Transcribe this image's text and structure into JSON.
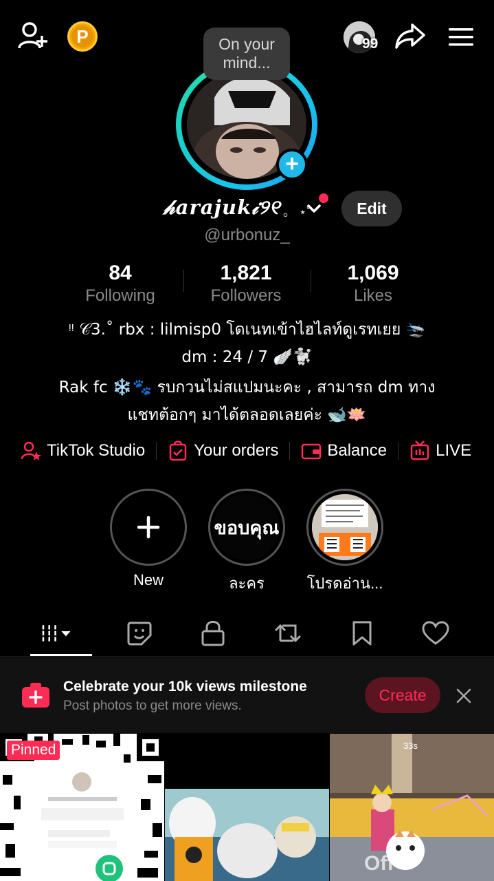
{
  "header": {
    "mind_bubble": "On your mind...",
    "friends_count_badge": "99",
    "icons": [
      "add-user-icon",
      "coin-icon",
      "share-icon",
      "menu-icon"
    ]
  },
  "profile": {
    "display_name": "𝒽arajuk𝒾୨୧",
    "name_decoration": "。 ⋆˚",
    "username": "@urbonuz_",
    "edit_label": "Edit"
  },
  "stats": [
    {
      "value": "84",
      "label": "Following"
    },
    {
      "value": "1,821",
      "label": "Followers"
    },
    {
      "value": "1,069",
      "label": "Likes"
    }
  ],
  "bio": {
    "line1": "ᵎᵎ 𝒞3.˚ rbx : lilmisp0 โดเนทเข้าไฮไลท์ดูเรทเยย 🛬",
    "line2": "dm : 24 / 7 🪽🐩",
    "line3": "Rak fc ❄️🐾 รบกวนไม่สแปมนะคะ , สามารถ dm ทาง",
    "line4": "แชทต้อกๆ มาได้ตลอดเลยค่ะ 🐋🪷"
  },
  "quick_links": [
    {
      "label": "TikTok Studio",
      "icon": "studio-icon"
    },
    {
      "label": "Your orders",
      "icon": "orders-icon"
    },
    {
      "label": "Balance",
      "icon": "wallet-icon"
    },
    {
      "label": "LIVE",
      "icon": "live-icon"
    }
  ],
  "highlights": [
    {
      "label": "New"
    },
    {
      "label": "ละคร",
      "cover_text": "ขอบคุณ"
    },
    {
      "label": "โปรดอ่าน..."
    }
  ],
  "tabs": [
    "videos-grid-icon",
    "reposts-sticker-icon",
    "private-lock-icon",
    "repost-icon",
    "favorites-bookmark-icon",
    "liked-heart-icon"
  ],
  "banner": {
    "title": "Celebrate your 10k views milestone",
    "subtitle": "Post photos to get more views.",
    "button": "Create"
  },
  "grid": {
    "pinned_label": "Pinned",
    "timer": "33s",
    "overlay_text": "Off"
  },
  "colors": {
    "background": "#000000",
    "accent_red": "#fe2c55",
    "ring_cyan": "#19c6ea",
    "muted_text": "#8a8a8a"
  }
}
